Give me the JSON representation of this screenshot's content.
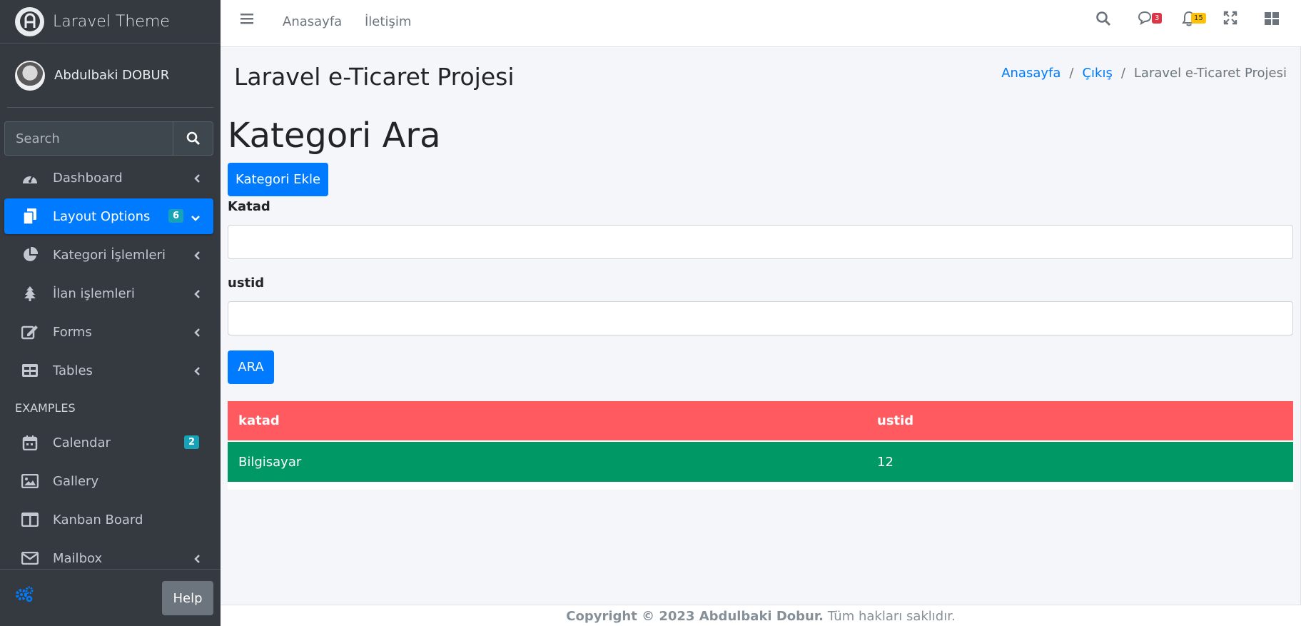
{
  "sidebar": {
    "brand": "Laravel Theme",
    "user_name": "Abdulbaki DOBUR",
    "search_placeholder": "Search",
    "items": [
      {
        "label": "Dashboard",
        "icon": "tachometer-icon"
      },
      {
        "label": "Layout Options",
        "icon": "copy-icon",
        "badge": "6",
        "active": true
      },
      {
        "label": "Kategori İşlemleri",
        "icon": "chart-pie-icon"
      },
      {
        "label": "İlan işlemleri",
        "icon": "tree-icon"
      },
      {
        "label": "Forms",
        "icon": "edit-icon"
      },
      {
        "label": "Tables",
        "icon": "table-icon"
      }
    ],
    "examples_header": "EXAMPLES",
    "examples": [
      {
        "label": "Calendar",
        "icon": "calendar-icon",
        "badge": "2"
      },
      {
        "label": "Gallery",
        "icon": "image-icon"
      },
      {
        "label": "Kanban Board",
        "icon": "columns-icon"
      },
      {
        "label": "Mailbox",
        "icon": "envelope-icon"
      }
    ],
    "help_label": "Help"
  },
  "topnav": {
    "links": [
      "Anasayfa",
      "İletişim"
    ],
    "messages_count": "3",
    "notifications_count": "15"
  },
  "header": {
    "title": "Laravel e-Ticaret Projesi",
    "breadcrumb": [
      "Anasayfa",
      "Çıkış",
      "Laravel e-Ticaret Projesi"
    ]
  },
  "main": {
    "heading": "Kategori Ara",
    "add_button": "Kategori Ekle",
    "field1_label": "Katad",
    "field1_value": "",
    "field2_label": "ustid",
    "field2_value": "",
    "search_button": "ARA",
    "table": {
      "headers": [
        "katad",
        "ustid"
      ],
      "rows": [
        [
          "Bilgisayar",
          "12"
        ]
      ]
    }
  },
  "footer": {
    "copyright": "Copyright © 2023 Abdulbaki Dobur.",
    "rights": "Tüm hakları saklıdır."
  },
  "colors": {
    "accent": "#007bff",
    "sidebar_bg": "#343a40",
    "table_head": "#ff5a5f",
    "table_row": "#009966"
  }
}
